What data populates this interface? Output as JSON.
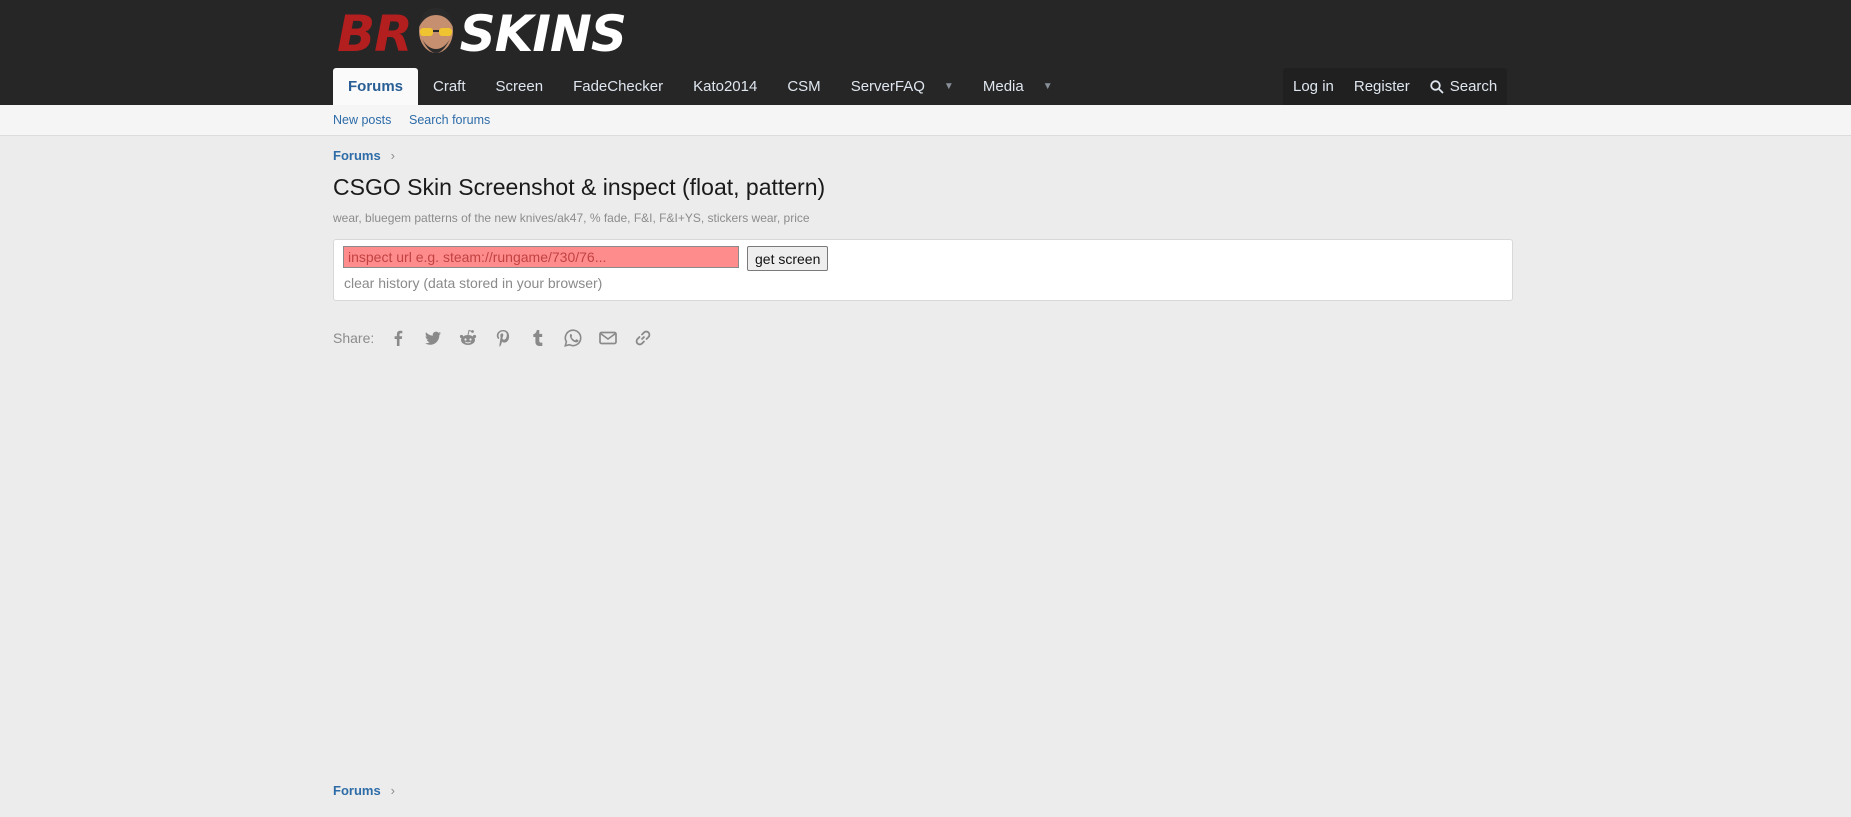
{
  "brand": {
    "logo_text_left": "BR",
    "logo_text_right": "SKINS",
    "colors": {
      "red": "#b31e1e",
      "header_bg": "#262626"
    }
  },
  "nav": {
    "tabs": [
      {
        "label": "Forums",
        "active": true
      },
      {
        "label": "Craft"
      },
      {
        "label": "Screen"
      },
      {
        "label": "FadeChecker"
      },
      {
        "label": "Kato2014"
      },
      {
        "label": "CSM"
      },
      {
        "label": "ServerFAQ",
        "dropdown": true
      },
      {
        "label": "Media",
        "dropdown": true
      }
    ],
    "right": {
      "login": "Log in",
      "register": "Register",
      "search": "Search"
    }
  },
  "subnav": {
    "new_posts": "New posts",
    "search_forums": "Search forums"
  },
  "breadcrumb": {
    "root": "Forums"
  },
  "page": {
    "title": "CSGO Skin Screenshot & inspect (float, pattern)",
    "description": "wear, bluegem patterns of the new knives/ak47, % fade, F&I, F&I+YS, stickers wear, price"
  },
  "inspect": {
    "placeholder": "inspect url e.g. steam://rungame/730/76...",
    "value": "",
    "button": "get screen",
    "clear_history": "clear history (data stored in your browser)"
  },
  "share": {
    "label": "Share:",
    "icons": [
      "facebook-icon",
      "twitter-icon",
      "reddit-icon",
      "pinterest-icon",
      "tumblr-icon",
      "whatsapp-icon",
      "email-icon",
      "link-icon"
    ]
  },
  "footer": {
    "breadcrumb_root": "Forums"
  }
}
